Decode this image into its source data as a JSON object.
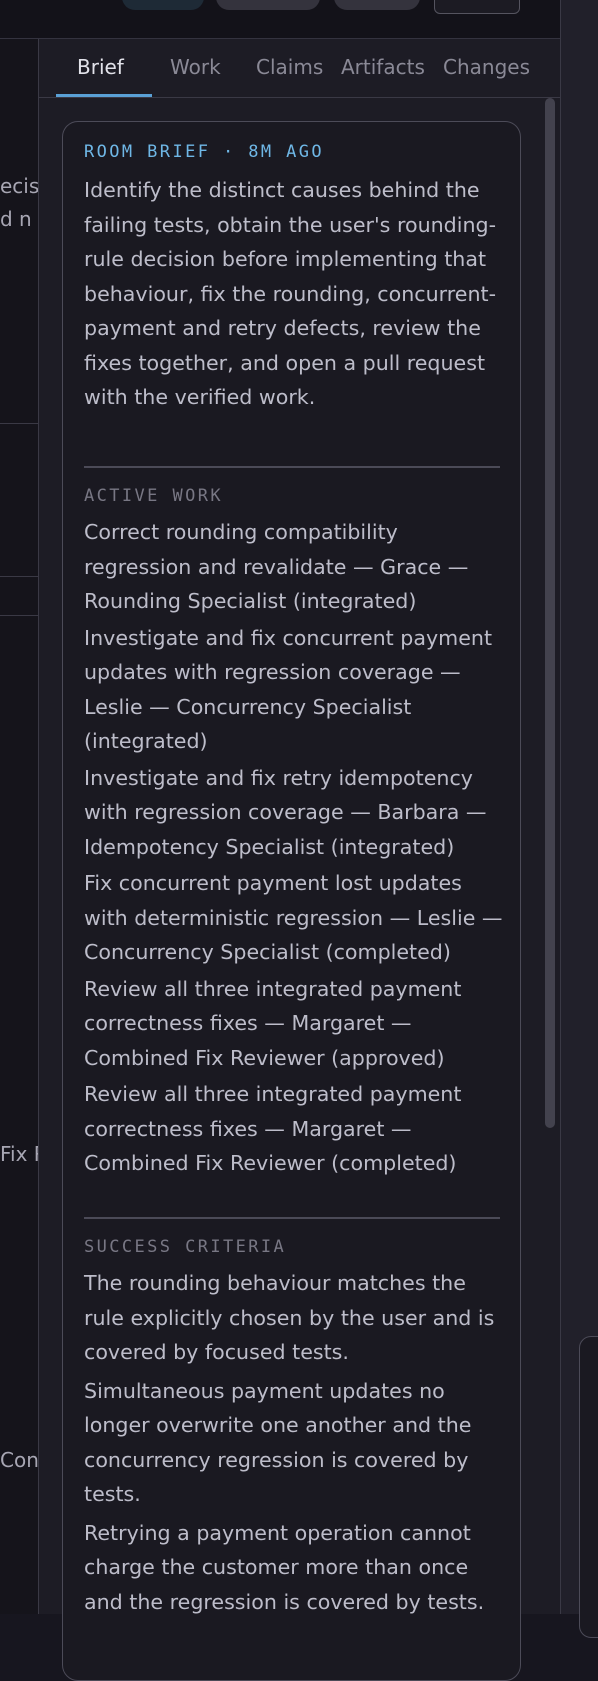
{
  "tabs": [
    "Brief",
    "Work",
    "Claims",
    "Artifacts",
    "Changes"
  ],
  "left_fragments": [
    "ecis",
    "d n",
    "Fix R",
    "Con"
  ],
  "brief": {
    "header": "ROOM BRIEF · 8M AGO",
    "summary": "Identify the distinct causes behind the failing tests, obtain the user's rounding-rule decision before implementing that behaviour, fix the rounding, concurrent-payment and retry defects, review the fixes together, and open a pull request with the verified work.",
    "active_work_title": "ACTIVE WORK",
    "active_work": [
      "Correct rounding compatibility regression and revalidate — Grace — Rounding Specialist (integrated)",
      "Investigate and fix concurrent payment updates with regression coverage — Leslie — Concurrency Specialist (integrated)",
      "Investigate and fix retry idempotency with regression coverage — Barbara — Idempotency Specialist (integrated)",
      "Fix concurrent payment lost updates with deterministic regression — Leslie — Concurrency Specialist (completed)",
      "Review all three integrated payment correctness fixes — Margaret — Combined Fix Reviewer (approved)",
      "Review all three integrated payment correctness fixes — Margaret — Combined Fix Reviewer (completed)"
    ],
    "success_title": "SUCCESS CRITERIA",
    "success_criteria": [
      "The rounding behaviour matches the rule explicitly chosen by the user and is covered by focused tests.",
      "Simultaneous payment updates no longer overwrite one another and the concurrency regression is covered by tests.",
      "Retrying a payment operation cannot charge the customer more than once and the regression is covered by tests."
    ]
  }
}
